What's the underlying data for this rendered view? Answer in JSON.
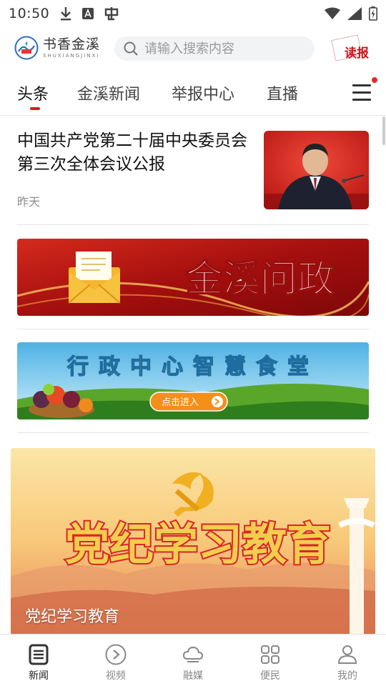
{
  "status_bar": {
    "time": "10:50",
    "left_icons": [
      "download-icon",
      "a-notification-icon",
      "bug-icon"
    ],
    "right_icons": [
      "wifi-icon",
      "signal-icon",
      "battery-charging-icon"
    ]
  },
  "header": {
    "logo_text": "书香金溪",
    "logo_subtext": "SHUXIANGJINXI",
    "search_placeholder": "请输入搜索内容",
    "read_report_label": "读报"
  },
  "tabs": [
    {
      "label": "头条",
      "active": true
    },
    {
      "label": "金溪新闻",
      "active": false
    },
    {
      "label": "举报中心",
      "active": false
    },
    {
      "label": "直播",
      "active": false
    }
  ],
  "feed": {
    "news": {
      "title": "中国共产党第二十届中央委员会第三次全体会议公报",
      "time": "昨天"
    },
    "banner1": {
      "text": "金溪问政"
    },
    "banner2": {
      "text": "行政中心智慧食堂",
      "button": "点击进入"
    },
    "big_card": {
      "image_text": "党纪学习教育",
      "caption": "党纪学习教育"
    }
  },
  "bottom_nav": [
    {
      "label": "新闻",
      "icon": "news-icon",
      "active": true
    },
    {
      "label": "视频",
      "icon": "video-play-icon",
      "active": false
    },
    {
      "label": "融媒",
      "icon": "cloud-icon",
      "active": false
    },
    {
      "label": "便民",
      "icon": "grid-icon",
      "active": false
    },
    {
      "label": "我的",
      "icon": "user-icon",
      "active": false
    }
  ],
  "colors": {
    "accent": "#d71f1f",
    "tab_text": "#444444",
    "nav_inactive": "#888888"
  }
}
